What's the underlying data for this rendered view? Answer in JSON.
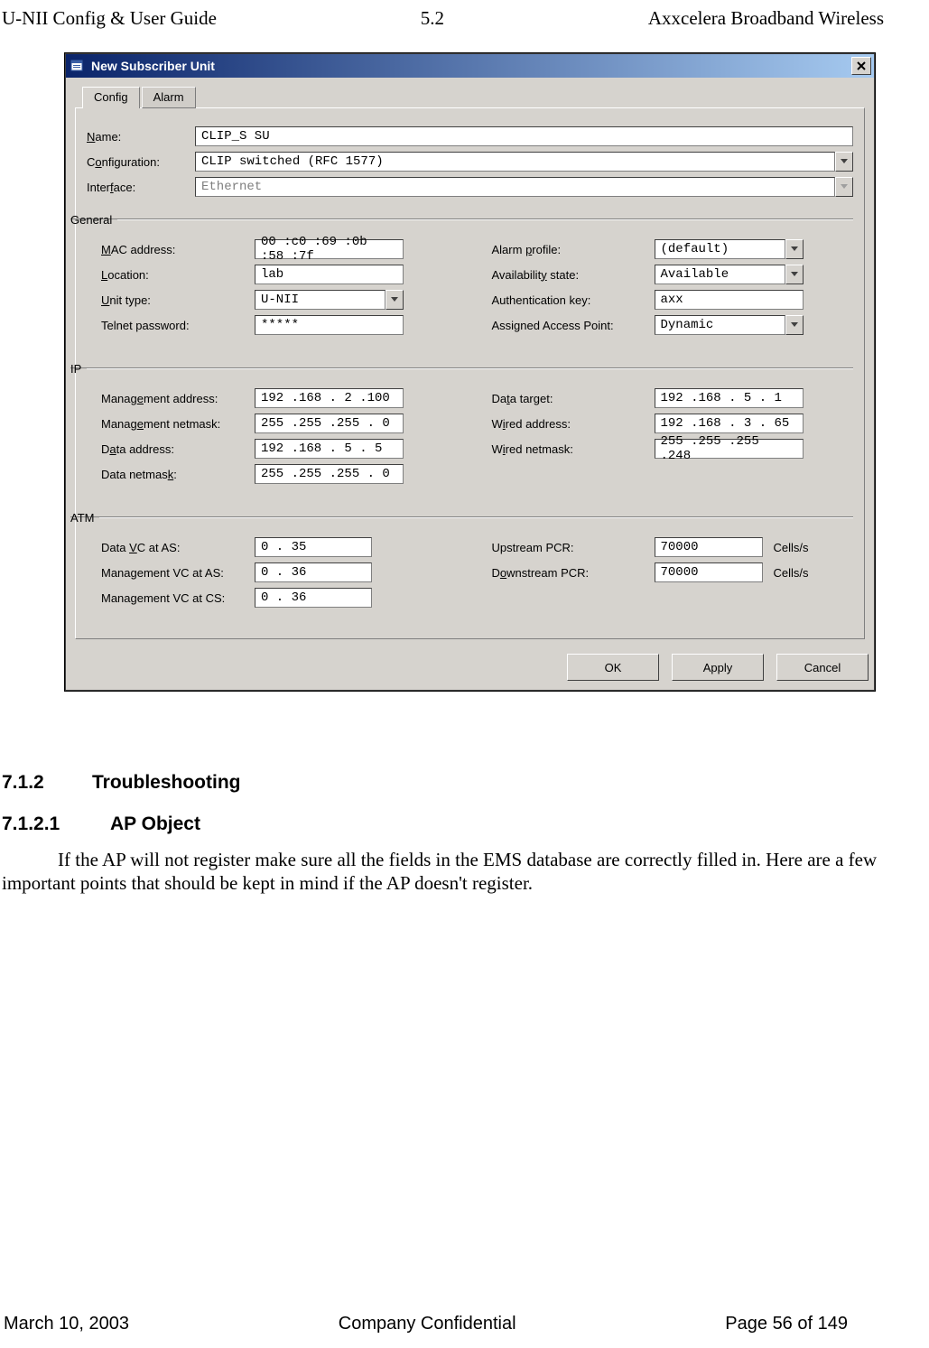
{
  "doc": {
    "header_left": "U-NII Config & User Guide",
    "header_center": "5.2",
    "header_right": "Axxcelera Broadband Wireless",
    "footer_left": "March 10, 2003",
    "footer_center": "Company Confidential",
    "footer_right": "Page 56 of 149"
  },
  "window": {
    "title": "New Subscriber Unit",
    "tabs": {
      "config": "Config",
      "alarm": "Alarm"
    },
    "labels": {
      "name": "Name:",
      "configuration": "Configuration:",
      "interface": "Interface:"
    },
    "name_value": "CLIP_S SU",
    "configuration_value": "CLIP switched (RFC 1577)",
    "interface_value": "Ethernet",
    "group_general": "General",
    "general": {
      "mac_label": "MAC address:",
      "mac_value": "00 :c0 :69 :0b :58 :7f",
      "location_label": "Location:",
      "location_value": "lab",
      "unit_type_label": "Unit type:",
      "unit_type_value": "U-NII",
      "telnet_label": "Telnet password:",
      "telnet_value": "*****",
      "alarm_profile_label": "Alarm profile:",
      "alarm_profile_value": "(default)",
      "avail_label": "Availability state:",
      "avail_value": "Available",
      "auth_label": "Authentication key:",
      "auth_value": "axx",
      "assigned_ap_label": "Assigned Access Point:",
      "assigned_ap_value": "Dynamic"
    },
    "group_ip": "IP",
    "ip": {
      "mgmt_addr_label": "Management address:",
      "mgmt_addr_value": "192 .168 . 2  .100",
      "mgmt_mask_label": "Management netmask:",
      "mgmt_mask_value": "255 .255 .255 . 0",
      "data_addr_label": "Data address:",
      "data_addr_value": "192 .168 . 5  . 5",
      "data_mask_label": "Data netmask:",
      "data_mask_value": "255 .255 .255 . 0",
      "data_target_label": "Data target:",
      "data_target_value": "192 .168 . 5  . 1",
      "wired_addr_label": "Wired address:",
      "wired_addr_value": "192 .168 . 3  . 65",
      "wired_mask_label": "Wired netmask:",
      "wired_mask_value": "255 .255 .255 .248"
    },
    "group_atm": "ATM",
    "atm": {
      "data_vc_as_label": "Data VC at AS:",
      "data_vc_as_value": " 0  .  35",
      "mgmt_vc_as_label": "Management VC at AS:",
      "mgmt_vc_as_value": " 0  .  36",
      "mgmt_vc_cs_label": "Management VC at CS:",
      "mgmt_vc_cs_value": " 0  .  36",
      "up_pcr_label": "Upstream PCR:",
      "up_pcr_value": "70000",
      "down_pcr_label": "Downstream PCR:",
      "down_pcr_value": "70000",
      "unit": "Cells/s"
    },
    "buttons": {
      "ok": "OK",
      "apply": "Apply",
      "cancel": "Cancel"
    }
  },
  "sections": {
    "s1_num": "7.1.2",
    "s1_title": "Troubleshooting",
    "s2_num": "7.1.2.1",
    "s2_title": "AP Object",
    "para": "If the AP will not register make sure all the fields in the EMS database are correctly filled in. Here are a few important points that should be kept in mind if the AP doesn't register."
  }
}
